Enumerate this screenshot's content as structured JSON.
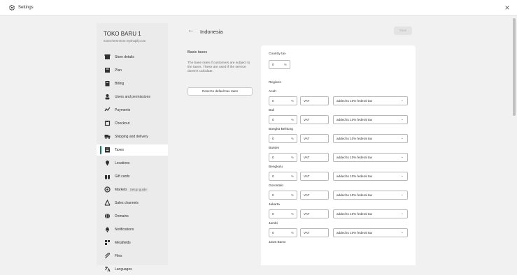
{
  "window": {
    "title": "Settings",
    "icon": "gear-icon"
  },
  "sidebar": {
    "store_name": "TOKO BARU 1",
    "store_url": "marcel-test-store.myshopify.com",
    "items": [
      {
        "label": "Store details",
        "icon": "store-icon"
      },
      {
        "label": "Plan",
        "icon": "plan-icon"
      },
      {
        "label": "Billing",
        "icon": "billing-icon"
      },
      {
        "label": "Users and permissions",
        "icon": "users-icon"
      },
      {
        "label": "Payments",
        "icon": "payments-icon"
      },
      {
        "label": "Checkout",
        "icon": "checkout-icon"
      },
      {
        "label": "Shipping and delivery",
        "icon": "truck-icon"
      },
      {
        "label": "Taxes",
        "icon": "taxes-icon",
        "active": true
      },
      {
        "label": "Locations",
        "icon": "location-icon"
      },
      {
        "label": "Gift cards",
        "icon": "gift-icon"
      },
      {
        "label": "Markets",
        "icon": "globe-icon",
        "badge": "Setup guide"
      },
      {
        "label": "Sales channels",
        "icon": "sales-channels-icon"
      },
      {
        "label": "Domains",
        "icon": "domains-icon"
      },
      {
        "label": "Notifications",
        "icon": "bell-icon"
      },
      {
        "label": "Metafields",
        "icon": "metafields-icon"
      },
      {
        "label": "Files",
        "icon": "files-icon"
      },
      {
        "label": "Languages",
        "icon": "languages-icon"
      }
    ]
  },
  "header": {
    "title": "Indonesia",
    "save_label": "Save"
  },
  "basic_taxes": {
    "heading": "Basic taxes",
    "description": "The base rates if customers are subject to the taxes. These are used if the service doesn't calculate.",
    "reset_label": "Reset to default tax rates"
  },
  "country_tax": {
    "label": "Country tax",
    "value": "0",
    "suffix": "%"
  },
  "regions_label": "Regions",
  "regions": [
    {
      "name": "Aceh",
      "rate": "0",
      "unit": "%",
      "tax_name": "VAT",
      "method": "added to 10% federal tax"
    },
    {
      "name": "Bali",
      "rate": "0",
      "unit": "%",
      "tax_name": "VAT",
      "method": "added to 10% federal tax"
    },
    {
      "name": "Bangka Belitung",
      "rate": "0",
      "unit": "%",
      "tax_name": "VAT",
      "method": "added to 10% federal tax"
    },
    {
      "name": "Banten",
      "rate": "0",
      "unit": "%",
      "tax_name": "VAT",
      "method": "added to 10% federal tax"
    },
    {
      "name": "Bengkulu",
      "rate": "0",
      "unit": "%",
      "tax_name": "VAT",
      "method": "added to 10% federal tax"
    },
    {
      "name": "Gorontalo",
      "rate": "0",
      "unit": "%",
      "tax_name": "VAT",
      "method": "added to 10% federal tax"
    },
    {
      "name": "Jakarta",
      "rate": "0",
      "unit": "%",
      "tax_name": "VAT",
      "method": "added to 10% federal tax"
    },
    {
      "name": "Jambi",
      "rate": "0",
      "unit": "%",
      "tax_name": "VAT",
      "method": "added to 10% federal tax"
    },
    {
      "name": "Jawa Barat",
      "rate": "",
      "unit": "",
      "tax_name": "",
      "method": ""
    }
  ],
  "colors": {
    "accent": "#008060",
    "background": "#f1f1f1",
    "card": "#ffffff"
  }
}
